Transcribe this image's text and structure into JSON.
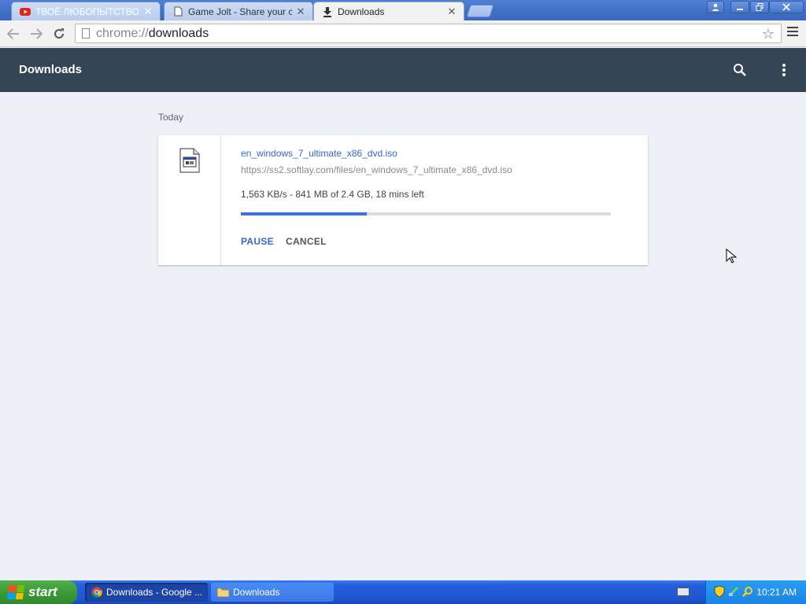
{
  "tabs": [
    {
      "title": "ТВОЁ ЛЮБОПЫТСТВО ТЕ",
      "icon": "youtube-icon"
    },
    {
      "title": "Game Jolt - Share your creati",
      "icon": "page-icon"
    },
    {
      "title": "Downloads",
      "icon": "download-icon"
    }
  ],
  "omnibox": {
    "scheme": "chrome://",
    "host": "downloads"
  },
  "header": {
    "title": "Downloads"
  },
  "section": {
    "date": "Today"
  },
  "download": {
    "filename": "en_windows_7_ultimate_x86_dvd.iso",
    "url": "https://ss2.softlay.com/files/en_windows_7_ultimate_x86_dvd.iso",
    "status": "1,563 KB/s - 841 MB of 2.4 GB, 18 mins left",
    "progress_fraction": 0.34,
    "pause_label": "PAUSE",
    "cancel_label": "CANCEL"
  },
  "taskbar": {
    "start_label": "start",
    "items": [
      {
        "label": "Downloads - Google ...",
        "icon": "chrome-icon"
      },
      {
        "label": "Downloads",
        "icon": "folder-icon"
      }
    ],
    "clock": "10:21 AM"
  },
  "colors": {
    "accent": "#3367d6",
    "header_bg": "#344556",
    "page_bg": "#eef0f7"
  }
}
